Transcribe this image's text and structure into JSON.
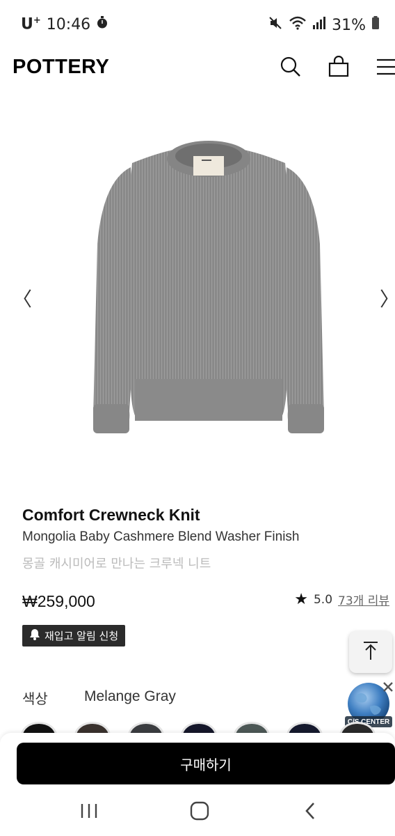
{
  "status_bar": {
    "carrier": "U",
    "carrier_plus": "+",
    "time": "10:46",
    "battery": "31%",
    "icons": [
      "timer-icon",
      "mute-icon",
      "wifi-icon",
      "signal-icon",
      "battery-icon"
    ]
  },
  "header": {
    "logo": "POTTERY",
    "icons": [
      "search-icon",
      "shopping-bag-icon",
      "menu-icon"
    ]
  },
  "carousel": {
    "prev": "〈",
    "next": "〉",
    "image": "gray-crewneck-sweater"
  },
  "product": {
    "name": "Comfort Crewneck Knit",
    "subtitle": "Mongolia Baby Cashmere Blend Washer Finish",
    "korean_desc": "몽골 캐시미어로 만나는 크루넥 니트",
    "price": "₩259,000",
    "rating": "5.0",
    "reviews": "73개 리뷰",
    "restock_label": "재입고 알림 신청"
  },
  "options": {
    "color_label": "색상",
    "color_value": "Melange Gray",
    "swatch_colors": [
      "#111111",
      "#3a322e",
      "#3b3d40",
      "#15172a",
      "#4d5856",
      "#161a2e",
      "#2a2a2a"
    ]
  },
  "cs_badge": {
    "label": "C/S CENTER"
  },
  "buy": {
    "label": "구매하기"
  },
  "colors": {
    "buy_button": "#000000",
    "restock_bg": "#2b2b2b",
    "muted_text": "#bbbbbb"
  }
}
